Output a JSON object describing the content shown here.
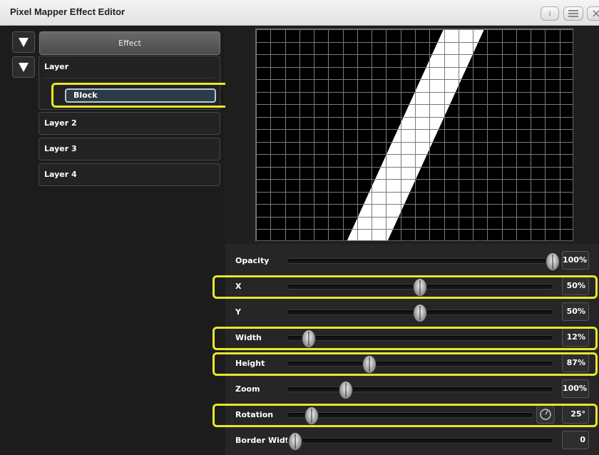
{
  "window": {
    "title": "Pixel Mapper Effect Editor",
    "info_label": "i"
  },
  "left_panel": {
    "effect_label": "Effect",
    "layer_label": "Layer",
    "selected_item": "Block",
    "layers": [
      "Layer 2",
      "Layer 3",
      "Layer 4"
    ]
  },
  "preview": {
    "columns": 22,
    "rows": 17,
    "pattern": "diagonal white band on black grid"
  },
  "sliders": [
    {
      "label": "Opacity",
      "value": "100%",
      "position": 1.0,
      "highlighted": false,
      "dial": false
    },
    {
      "label": "X",
      "value": "50%",
      "position": 0.5,
      "highlighted": true,
      "dial": false
    },
    {
      "label": "Y",
      "value": "50%",
      "position": 0.5,
      "highlighted": false,
      "dial": false
    },
    {
      "label": "Width",
      "value": "12%",
      "position": 0.08,
      "highlighted": true,
      "dial": false
    },
    {
      "label": "Height",
      "value": "87%",
      "position": 0.31,
      "highlighted": true,
      "dial": false
    },
    {
      "label": "Zoom",
      "value": "100%",
      "position": 0.22,
      "highlighted": false,
      "dial": false
    },
    {
      "label": "Rotation",
      "value": "25°",
      "position": 0.1,
      "highlighted": true,
      "dial": true
    },
    {
      "label": "Border Width",
      "value": "0",
      "position": 0.03,
      "highlighted": false,
      "dial": false
    }
  ],
  "colors": {
    "highlight": "#e8e62a",
    "background": "#1a1a1a",
    "grid_line": "#7a7a7a"
  },
  "icons": {
    "collapse": "triangle-down-icon",
    "rotation_dial": "dial-icon",
    "menu": "menu-icon",
    "close": "close-icon"
  }
}
